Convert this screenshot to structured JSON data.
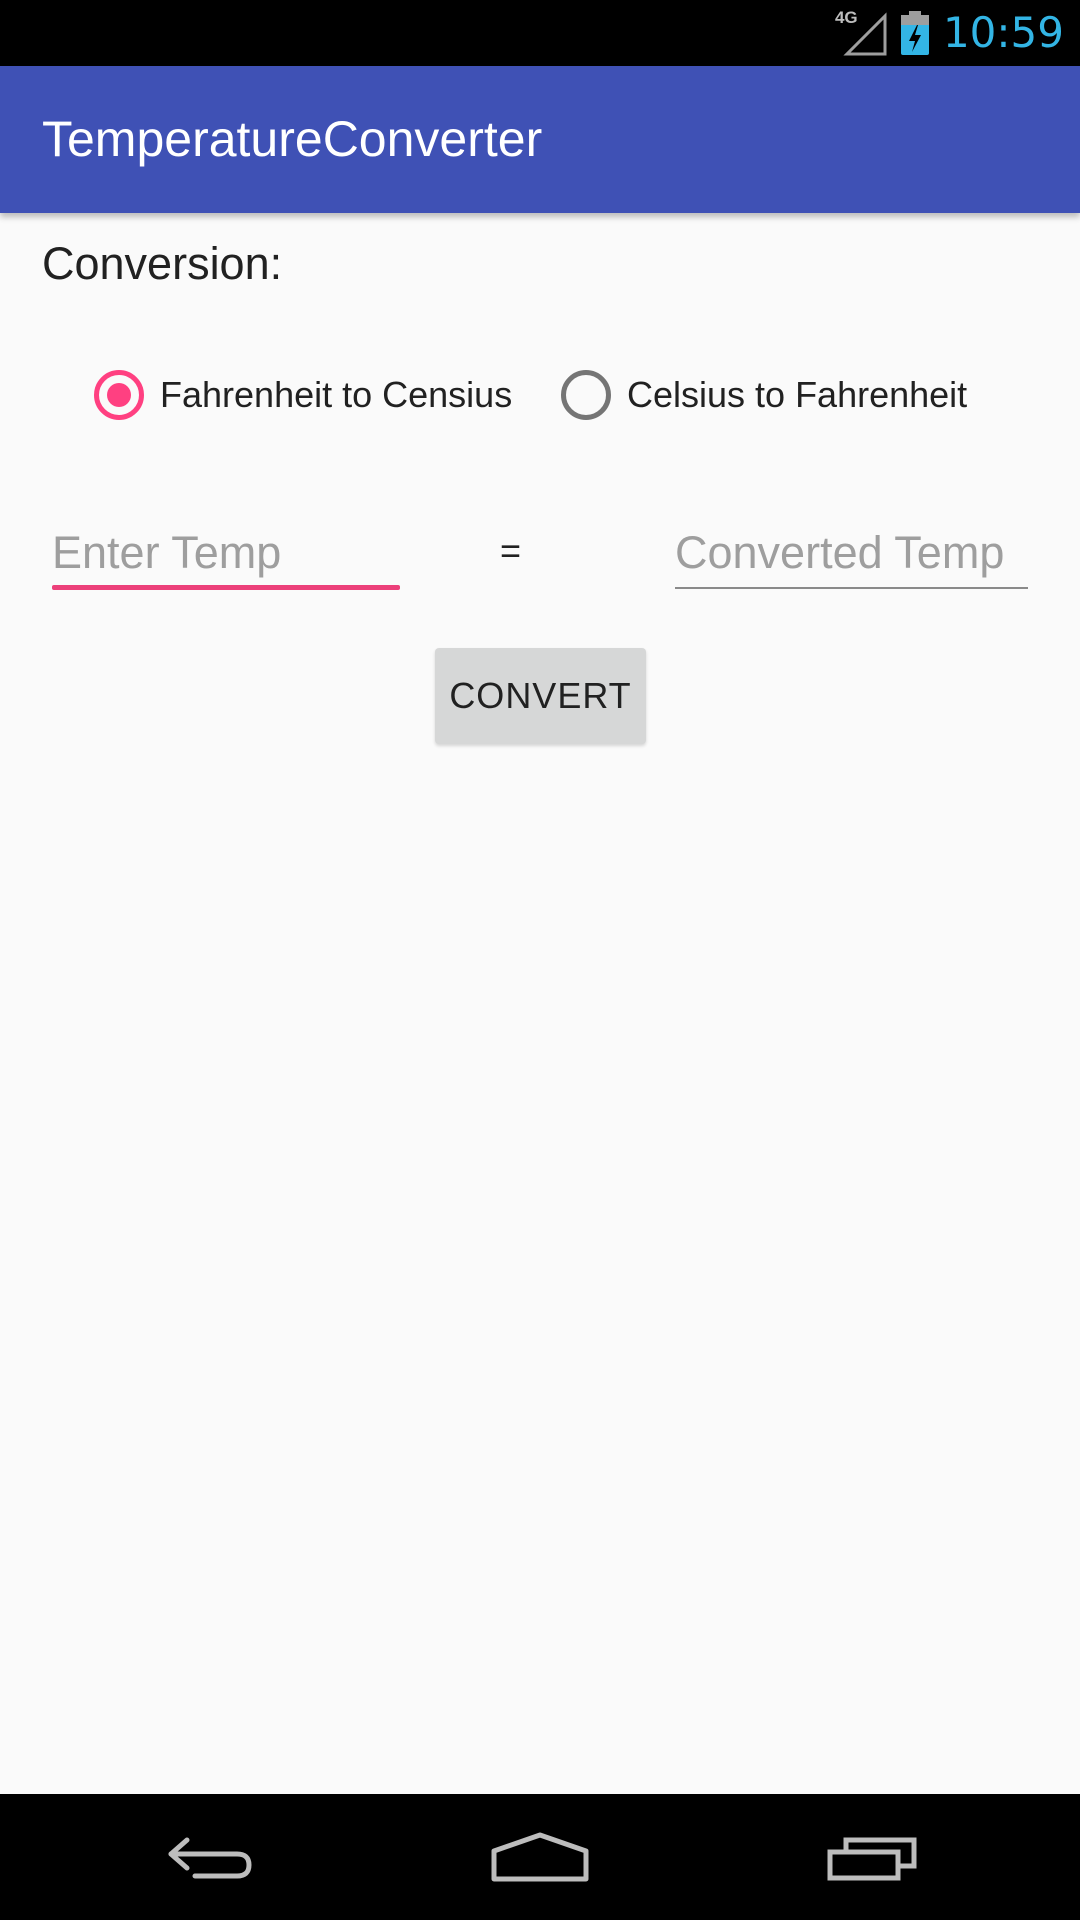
{
  "status_bar": {
    "network": "4G",
    "time": "10:59",
    "clock_color": "#33b5e5"
  },
  "app_bar": {
    "title": "TemperatureConverter",
    "color": "#3f51b5"
  },
  "content": {
    "conversion_label": "Conversion:",
    "radios": [
      {
        "label": "Fahrenheit to Censius",
        "checked": true
      },
      {
        "label": "Celsius to Fahrenheit",
        "checked": false
      }
    ],
    "enter_temp": {
      "value": "",
      "placeholder": "Enter Temp"
    },
    "equals": "=",
    "converted_temp": {
      "value": "",
      "placeholder": "Converted Temp"
    },
    "convert_button": "CONVERT",
    "accent_color": "#ff4081"
  },
  "nav_bar": {
    "icons": [
      "back-icon",
      "home-icon",
      "recent-apps-icon"
    ]
  }
}
